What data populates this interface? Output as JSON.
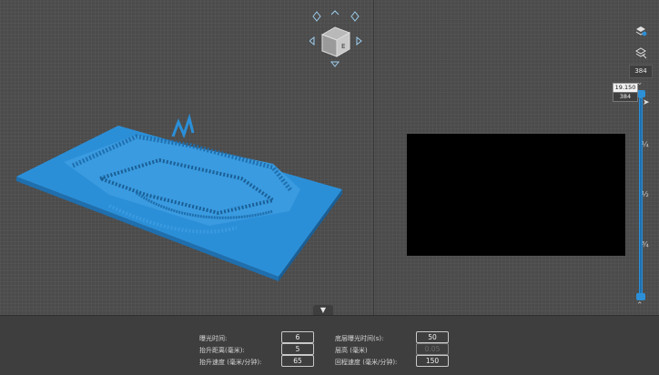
{
  "slicer": {
    "bottom_panel": {
      "collapse_icon": "triangle-down",
      "fields": [
        {
          "label": "曝光时间:",
          "value": "6"
        },
        {
          "label": "抬升距离(毫米):",
          "value": "5"
        },
        {
          "label": "抬升速度 (毫米/分钟):",
          "value": "65"
        },
        {
          "label": "底层曝光时间(s):",
          "value": "50"
        },
        {
          "label": "层高 (毫米)",
          "value": "0.05"
        },
        {
          "label": "回程速度 (毫米/分钟):",
          "value": "150"
        }
      ]
    },
    "toolbar": {
      "icons": [
        "layers-icon",
        "layers-slice-icon"
      ],
      "layer_top": "384",
      "slider_value_tip": "19.150",
      "slider_layer_tip": "384",
      "fractions": [
        "¼",
        "½",
        "¾"
      ]
    },
    "view_cube": {
      "label": "E",
      "nav_icons": [
        "arrow-up",
        "arrow-left",
        "arrow-right",
        "arrow-down",
        "rotate"
      ]
    },
    "colors": {
      "model": "#2b8fd8",
      "model_dark": "#1f6fae",
      "slice_bg": "#000000",
      "slider": "#2d8fd6"
    }
  }
}
